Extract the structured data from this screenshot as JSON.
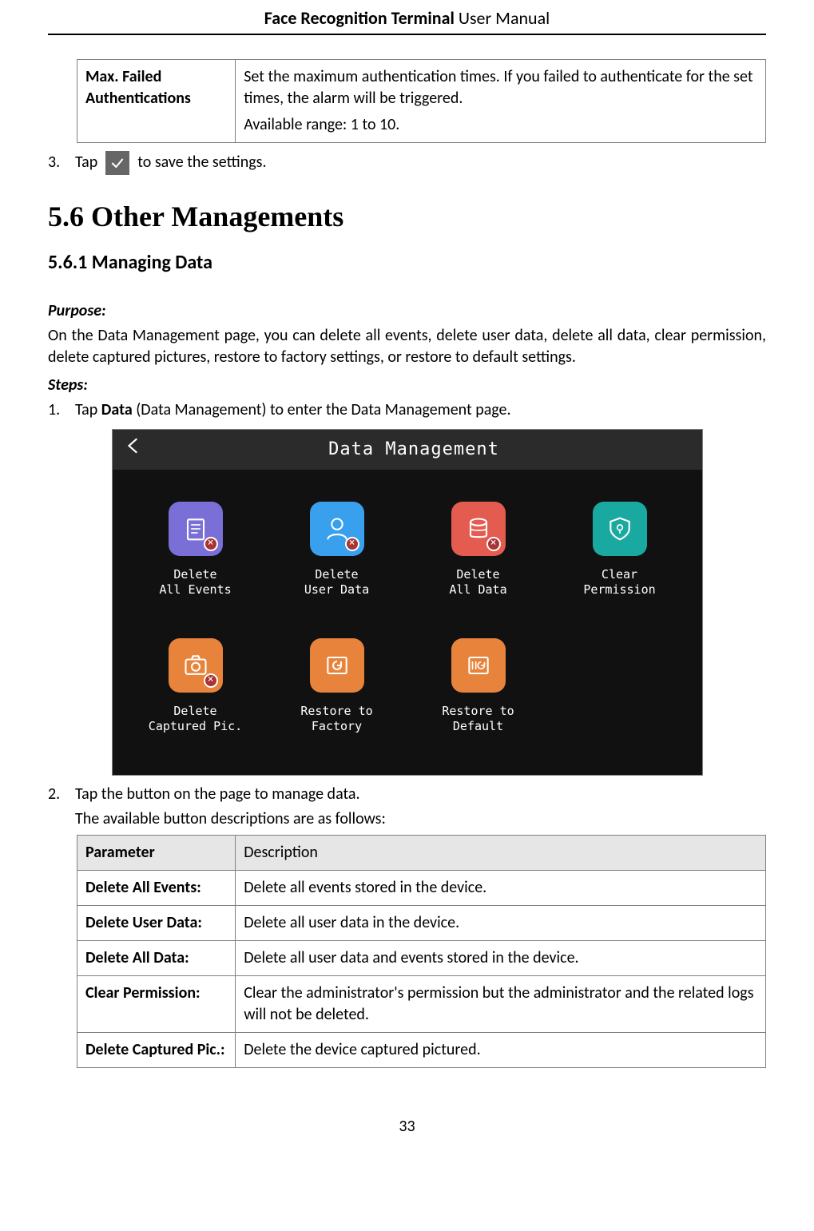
{
  "header": {
    "bold": "Face Recognition Terminal",
    "rest": "  User Manual"
  },
  "table1": {
    "param": "Max. Failed Authentications",
    "desc1": "Set the maximum authentication times. If you failed to authenticate for the set times, the alarm will be triggered.",
    "desc2": "Available range: 1 to 10."
  },
  "step3": {
    "num": "3.",
    "pre": "Tap",
    "post": "to save the settings."
  },
  "sec": {
    "num_title": "5.6  Other Managements"
  },
  "sub": {
    "num_title": "5.6.1   Managing Data"
  },
  "purpose": {
    "label": "Purpose:",
    "text": "On the Data Management page, you can delete all events, delete user data, delete all data, clear permission, delete captured pictures, restore to factory settings, or restore to default settings."
  },
  "steps": {
    "label": "Steps:",
    "s1": {
      "num": "1.",
      "text_pre": "Tap ",
      "bold": "Data",
      "text_post": " (Data Management) to enter the Data Management page."
    },
    "s2": {
      "num": "2.",
      "text": "Tap the button on the page to manage data.",
      "sub": "The available button descriptions are as follows:"
    }
  },
  "device": {
    "title": "Data Management",
    "items": [
      {
        "l1": "Delete",
        "l2": "All Events"
      },
      {
        "l1": "Delete",
        "l2": "User Data"
      },
      {
        "l1": "Delete",
        "l2": "All Data"
      },
      {
        "l1": "Clear",
        "l2": "Permission"
      },
      {
        "l1": "Delete",
        "l2": "Captured Pic."
      },
      {
        "l1": "Restore to",
        "l2": "Factory"
      },
      {
        "l1": "Restore to",
        "l2": "Default"
      }
    ]
  },
  "table2": {
    "h1": "Parameter",
    "h2": "Description",
    "rows": [
      {
        "p": "Delete All Events:",
        "d": "Delete all events stored in the device."
      },
      {
        "p": "Delete User Data:",
        "d": "Delete all user data in the device."
      },
      {
        "p": "Delete All Data:",
        "d": "Delete all user data and events stored in the device."
      },
      {
        "p": "Clear Permission:",
        "d": "Clear the administrator's permission but the administrator and the related logs will not be deleted."
      },
      {
        "p": "Delete Captured Pic.:",
        "d": "Delete the device captured pictured."
      }
    ]
  },
  "page_num": "33"
}
